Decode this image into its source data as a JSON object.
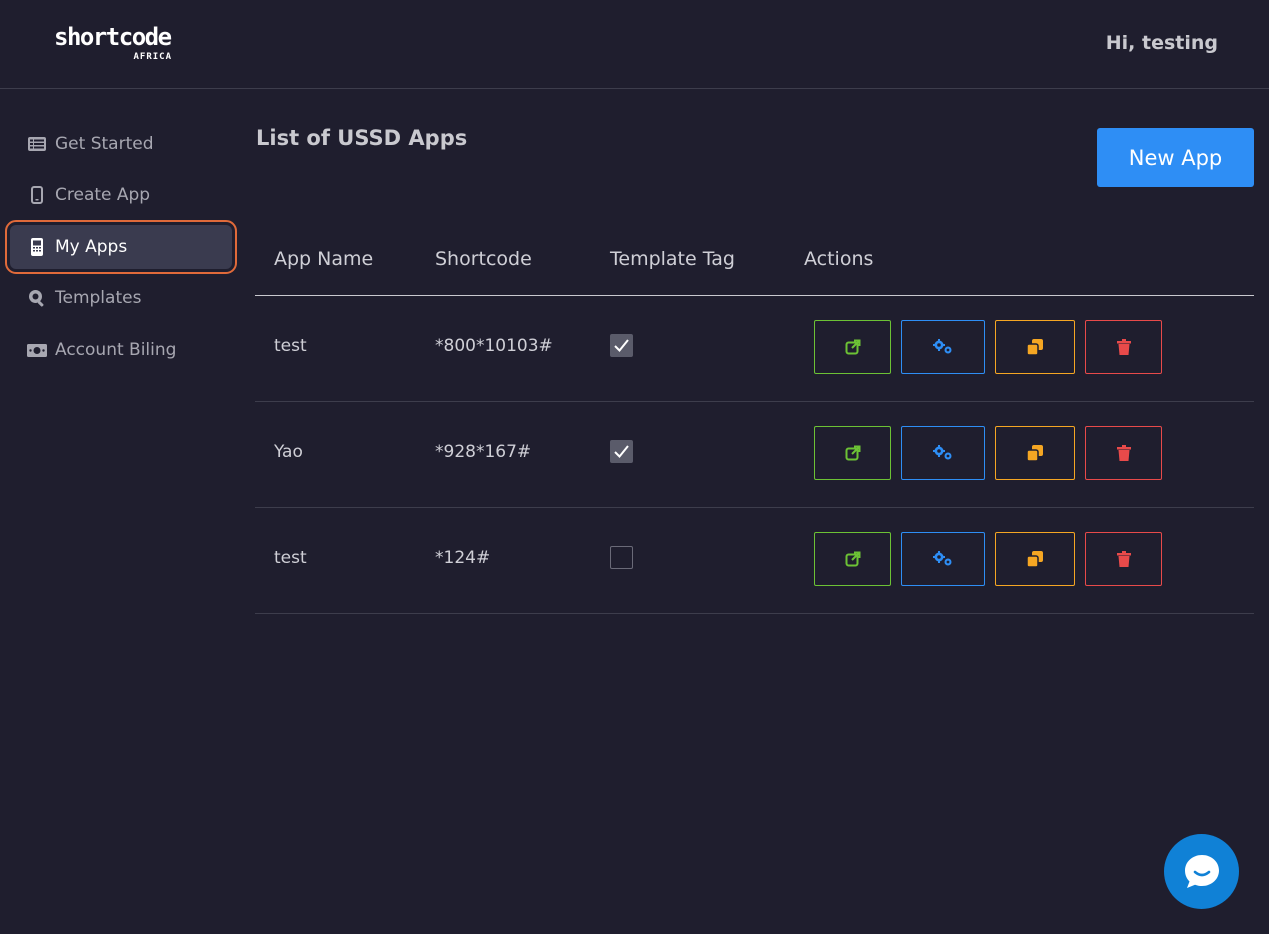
{
  "header": {
    "logo_main": "shortcode",
    "logo_sub": "AFRICA",
    "greeting": "Hi, testing"
  },
  "sidebar": {
    "items": [
      {
        "label": "Get Started",
        "icon": "list-icon",
        "active": false
      },
      {
        "label": "Create App",
        "icon": "mobile-icon",
        "active": false
      },
      {
        "label": "My Apps",
        "icon": "mobile-alt-icon",
        "active": true
      },
      {
        "label": "Templates",
        "icon": "search-icon",
        "active": false
      },
      {
        "label": "Account Biling",
        "icon": "money-bill-icon",
        "active": false
      }
    ]
  },
  "main": {
    "title": "List of USSD Apps",
    "new_app_label": "New App",
    "table": {
      "headers": [
        "App Name",
        "Shortcode",
        "Template Tag",
        "Actions"
      ],
      "rows": [
        {
          "app_name": "test",
          "shortcode": "*800*10103#",
          "template_tag": true
        },
        {
          "app_name": "Yao",
          "shortcode": "*928*167#",
          "template_tag": true
        },
        {
          "app_name": "test",
          "shortcode": "*124#",
          "template_tag": false
        }
      ],
      "actions": [
        {
          "icon": "external-link-icon",
          "color": "#6cc235"
        },
        {
          "icon": "cogs-icon",
          "color": "#2e8ef5"
        },
        {
          "icon": "copy-icon",
          "color": "#f5a623"
        },
        {
          "icon": "trash-icon",
          "color": "#e84a4a"
        }
      ]
    }
  },
  "colors": {
    "background": "#1f1e2e",
    "primary": "#2e8ef5",
    "active_outline": "#e06a3a",
    "chat": "#1081d6"
  }
}
